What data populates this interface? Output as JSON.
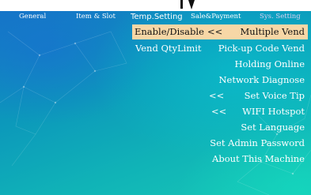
{
  "tabs": [
    {
      "label": "General"
    },
    {
      "label": "Item & Slot"
    },
    {
      "label": "Temp.Setting"
    },
    {
      "label": "Sale&Payment"
    },
    {
      "label": "Sys. Setting"
    }
  ],
  "menu": {
    "row1": {
      "left": "Enable/Disable",
      "marker": "<<",
      "right": "Multiple Vend"
    },
    "row2": {
      "left": "Vend QtyLimit",
      "right": "Pick-up Code Vend"
    },
    "row3": {
      "right": "Holding Online"
    },
    "row4": {
      "right": "Network Diagnose"
    },
    "row5": {
      "marker": "<<",
      "right": "Set Voice Tip"
    },
    "row6": {
      "marker": "<<",
      "right": "WIFI Hotspot"
    },
    "row7": {
      "right": "Set Language"
    },
    "row8": {
      "right": "Set Admin Password"
    },
    "row9": {
      "right": "About This Machine"
    }
  },
  "colors": {
    "selected_row_bg": "#f7d7a6",
    "background_start": "#1573c6",
    "background_end": "#18c9b6"
  }
}
